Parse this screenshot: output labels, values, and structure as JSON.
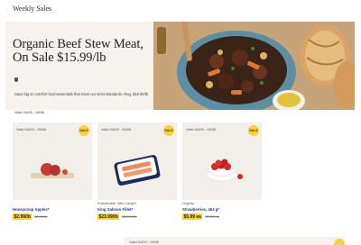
{
  "header": {
    "title": "Weekly Sales"
  },
  "hero": {
    "headline_line1": "Organic Beef Stew Meat,",
    "headline_line2": "On Sale $15.99/lb",
    "description": "Save big on comfort food essentials that meet our strict standards. Reg. $18.99/lb.",
    "valid": "Valid 04/09 - 06/06"
  },
  "cards": [
    {
      "valid": "Valid 04/09 - 06/06",
      "badge": "SALE",
      "subtitle": "",
      "name": "Honeycrisp Apples*",
      "sale_price": "$2.99/lb",
      "old_price": "$3.99/lb"
    },
    {
      "valid": "Valid 04/09 - 06/06",
      "badge": "SALE",
      "subtitle": "Sustainable, Wild Caught",
      "name": "King Salmon Fillet*",
      "sale_price": "$23.99/lb",
      "old_price": "$29.99/lb"
    },
    {
      "valid": "Valid 04/09 - 06/06",
      "badge": "SALE",
      "subtitle": "Organic",
      "name": "Strawberries, 454 g*",
      "sale_price": "$5.99 ea",
      "old_price": "$7.99 ea"
    }
  ],
  "next_card": {
    "valid": "Valid 04/09 - 06/06"
  },
  "colors": {
    "sale_yellow": "#f5d33a",
    "product_blue": "#1e3a8a",
    "card_bg": "#f2efea"
  }
}
